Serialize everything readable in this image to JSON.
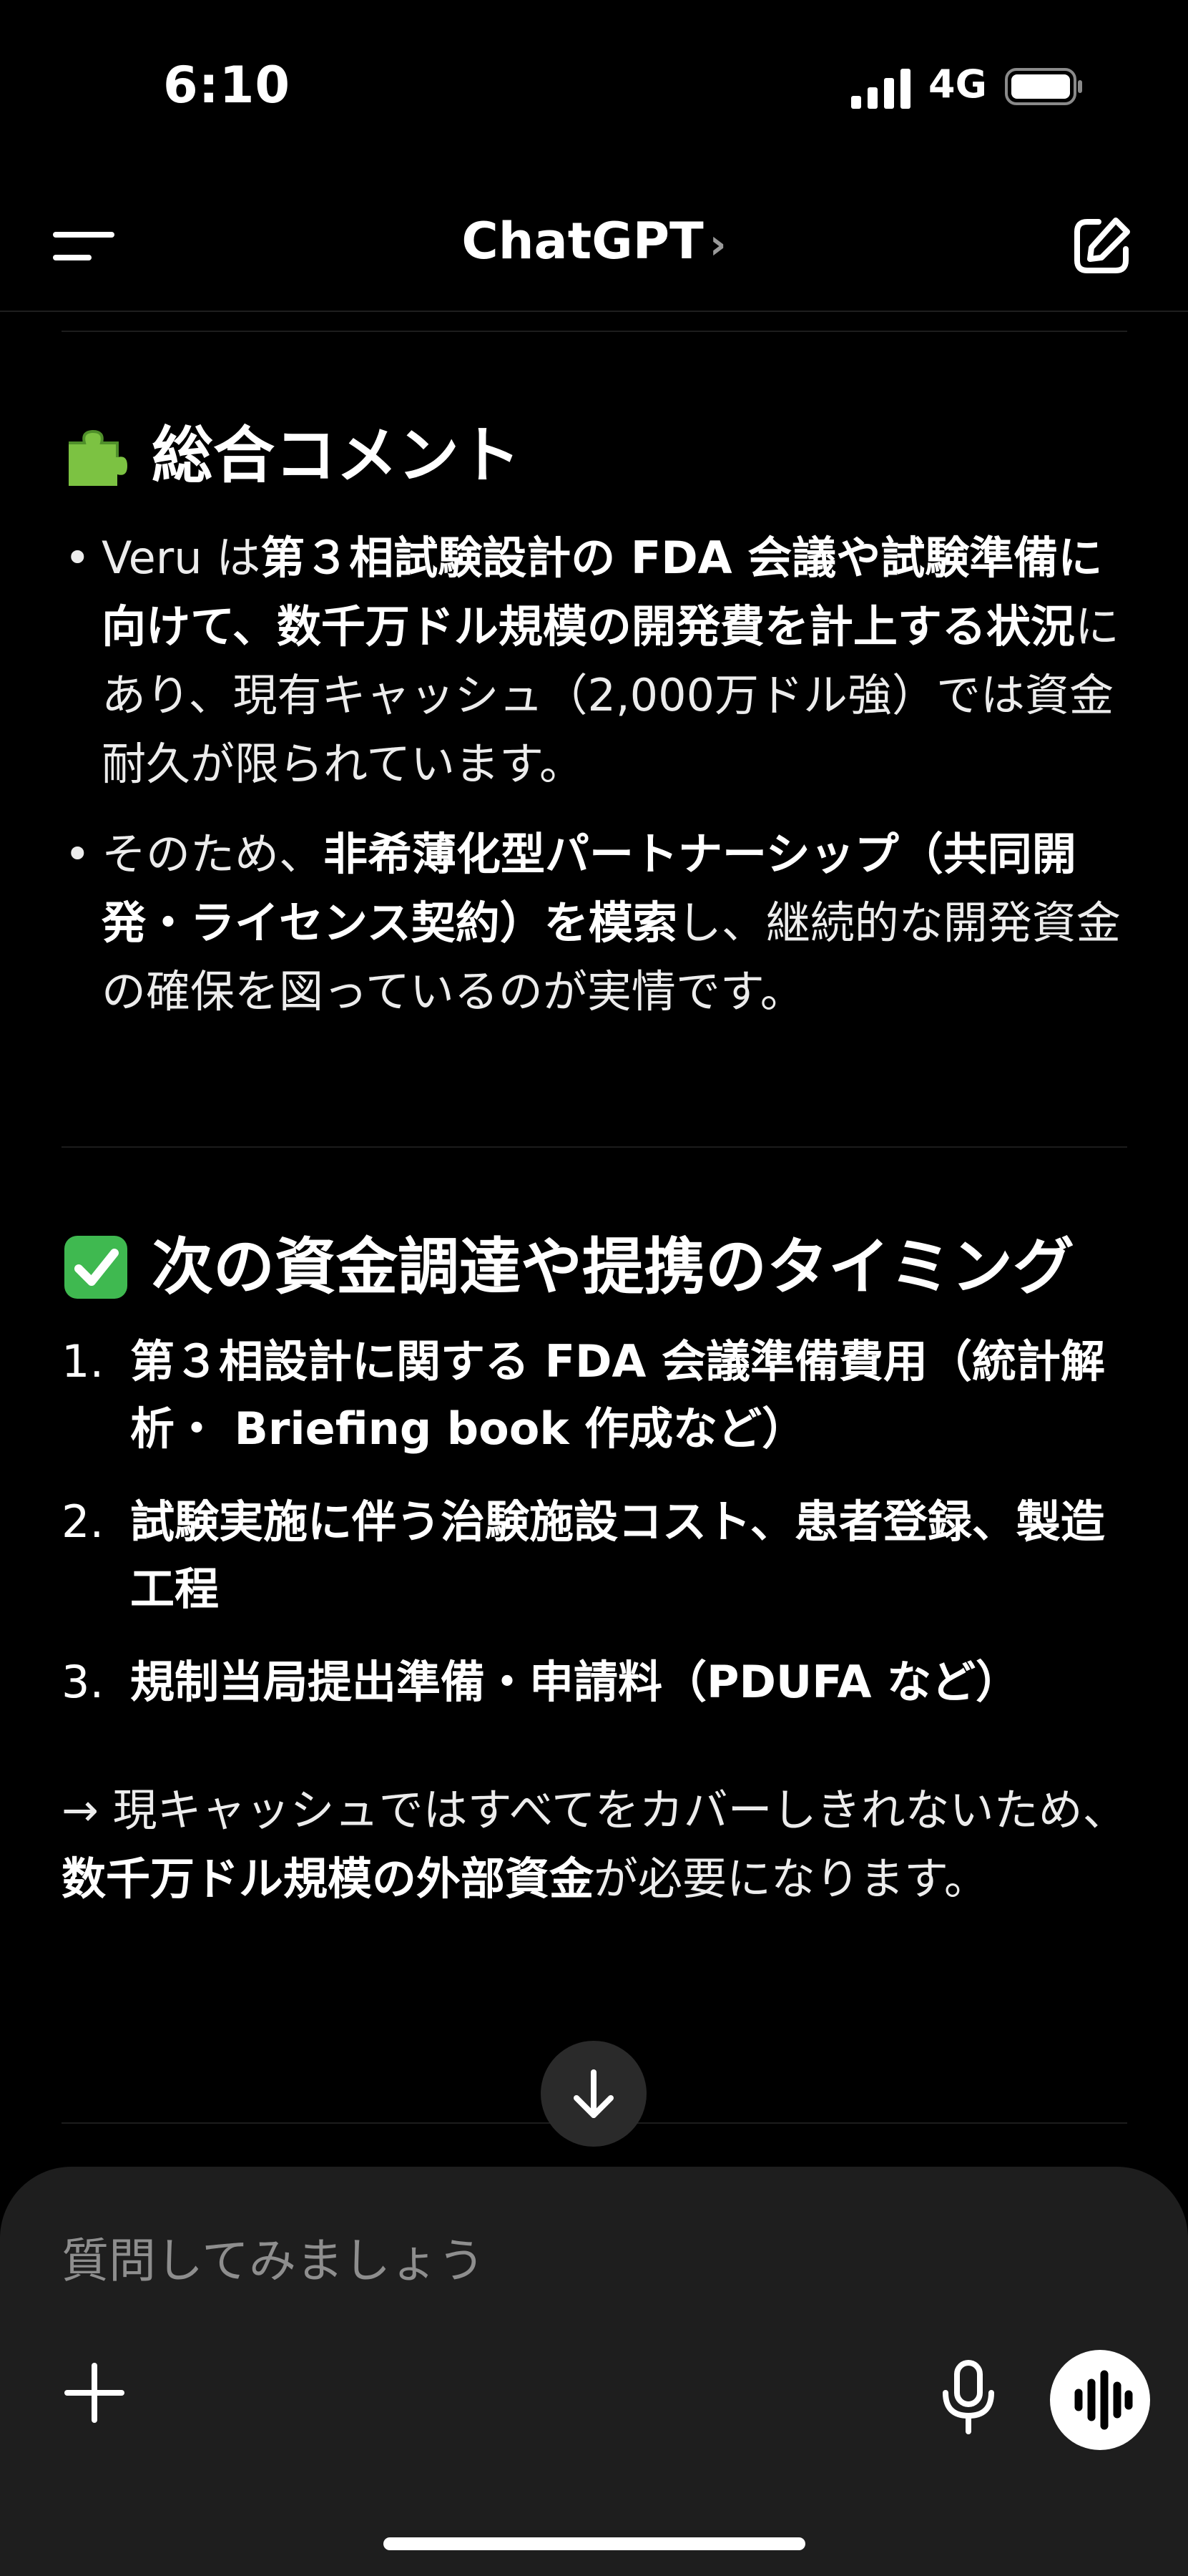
{
  "status_bar": {
    "time": "6:10",
    "network": "4G"
  },
  "header": {
    "title": "ChatGPT",
    "chevron": "›"
  },
  "sections": {
    "summary": {
      "heading": "総合コメント",
      "icon": "puzzle-piece-icon",
      "bullets": [
        {
          "dot": "•",
          "t1": "Veru は",
          "b1": "第３相試験設計の FDA 会議や試験準備に向けて、数千万ドル規模の開発費を計上する状況",
          "t2": "にあり、現有キャッシュ（2,000万ドル強）では資金耐久が限られています。"
        },
        {
          "dot": "•",
          "t1": "そのため、",
          "b1": "非希薄化型パートナーシップ（共同開発・ライセンス契約）を模索",
          "t2": "し、継続的な開発資金の確保を図っているのが実情です。"
        }
      ]
    },
    "next": {
      "heading": "次の資金調達や提携のタイミング",
      "icon": "check-mark-icon",
      "items": [
        {
          "num": "1.",
          "text": "第３相設計に関する FDA 会議準備費用（統計解析・ Briefing book 作成など）"
        },
        {
          "num": "2.",
          "text": "試験実施に伴う治験施設コスト、患者登録、製造工程"
        },
        {
          "num": "3.",
          "text": "規制当局提出準備・申請料（PDUFA など）"
        }
      ],
      "conclusion": {
        "t1": "→ 現キャッシュではすべてをカバーしきれないため、",
        "b1": "数千万ドル規模の外部資金",
        "t2": "が必要になります。"
      }
    }
  },
  "composer": {
    "placeholder": "質問してみましょう"
  },
  "colors": {
    "background": "#000000",
    "composer_bg": "#1e1e1e",
    "check_green": "#3fb950",
    "puzzle_green": "#7cc242"
  }
}
